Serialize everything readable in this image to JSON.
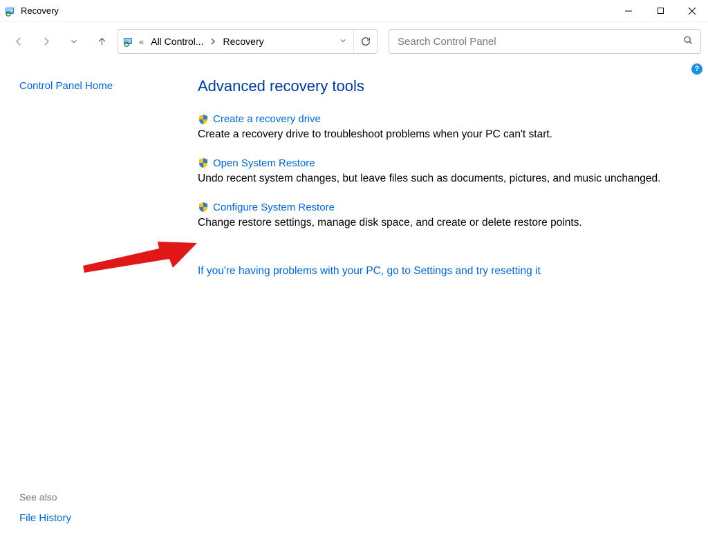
{
  "window": {
    "title": "Recovery"
  },
  "toolbar": {
    "breadcrumb_parent": "All Control...",
    "breadcrumb_current": "Recovery",
    "search_placeholder": "Search Control Panel"
  },
  "sidebar": {
    "home_link": "Control Panel Home",
    "see_also_label": "See also",
    "see_also_links": [
      "File History"
    ]
  },
  "main": {
    "heading": "Advanced recovery tools",
    "tools": [
      {
        "title": "Create a recovery drive",
        "desc": "Create a recovery drive to troubleshoot problems when your PC can't start."
      },
      {
        "title": "Open System Restore",
        "desc": "Undo recent system changes, but leave files such as documents, pictures, and music unchanged."
      },
      {
        "title": "Configure System Restore",
        "desc": "Change restore settings, manage disk space, and create or delete restore points."
      }
    ],
    "reset_link": "If you're having problems with your PC, go to Settings and try resetting it"
  },
  "help_badge": "?"
}
